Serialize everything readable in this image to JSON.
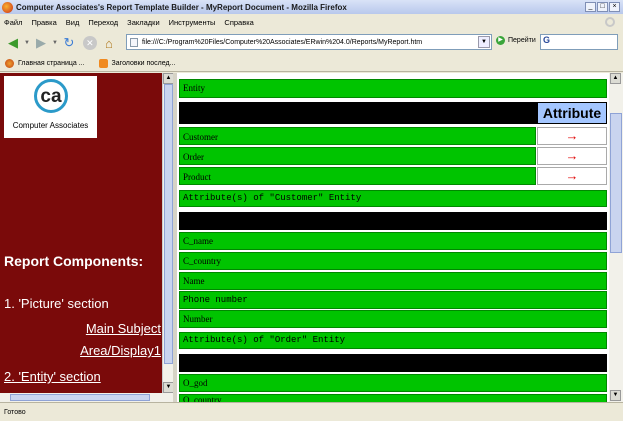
{
  "window": {
    "title": "Computer Associates's Report Template Builder - MyReport Document - Mozilla Firefox"
  },
  "menu": [
    "Файл",
    "Правка",
    "Вид",
    "Переход",
    "Закладки",
    "Инструменты",
    "Справка"
  ],
  "nav": {
    "url": "file:///C:/Program%20Files/Computer%20Associates/ERwin%204.0/Reports/MyReport.htm",
    "go_label": "Перейти",
    "search_text": "G"
  },
  "bookmarks": [
    "Главная страница ...",
    "Заголовки послед..."
  ],
  "left": {
    "logo_text": "ca",
    "logo_caption": "Computer Associates",
    "components_title": "Report Components:",
    "section1": "1. 'Picture' section",
    "link1": "Main Subject",
    "link2": "Area/Display1",
    "section2": "2. 'Entity' section"
  },
  "right": {
    "entity_header": "Entity",
    "attribute_header": "Attribute",
    "entities": [
      "Customer",
      "Order",
      "Product"
    ],
    "arrow_glyph": "→",
    "customer_attr_title": "Attribute(s) of \"Customer\" Entity",
    "customer_attrs": [
      "C_name",
      "C_country",
      "Name"
    ],
    "customer_attrs_mono": [
      "Phone number"
    ],
    "customer_attrs_tail": [
      "Number"
    ],
    "order_attr_title": "Attribute(s) of \"Order\" Entity",
    "order_attrs": [
      "O_god",
      "O_country"
    ]
  },
  "status": {
    "text": "Готово"
  },
  "colors": {
    "green": "#00c400",
    "maroon": "#7a0a0a",
    "attribute_blue": "#a4c6ff",
    "arrow_red": "#e00000"
  }
}
